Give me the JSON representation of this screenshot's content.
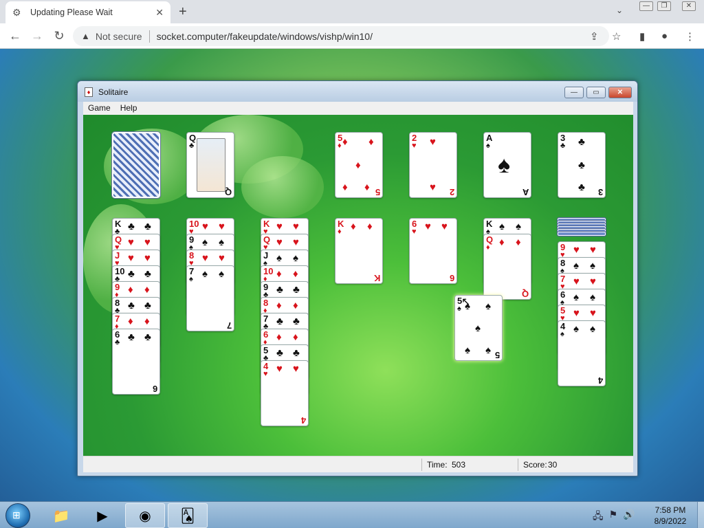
{
  "browser": {
    "tab_title": "Updating Please Wait",
    "tab_close": "✕",
    "new_tab": "+",
    "tab_search": "⌄",
    "minimize": "—",
    "restore": "❐",
    "close": "✕",
    "back": "←",
    "forward": "→",
    "reload": "↻",
    "security_label": "Not secure",
    "url": "socket.computer/fakeupdate/windows/vishp/win10/"
  },
  "window": {
    "title": "Solitaire",
    "menu": [
      "Game",
      "Help"
    ],
    "status": {
      "time_label": "Time:",
      "time_value": "503",
      "score_label": "Score:",
      "score_value": "30"
    }
  },
  "game": {
    "stock": {
      "face_down": true
    },
    "waste": {
      "rank": "Q",
      "suit": "♣"
    },
    "foundations": [
      {
        "rank": "5",
        "suit": "♦"
      },
      {
        "rank": "2",
        "suit": "♥"
      },
      {
        "rank": "A",
        "suit": "♠"
      },
      {
        "rank": "3",
        "suit": "♣"
      }
    ],
    "tableau": [
      {
        "cards": [
          "K♣",
          "Q♥",
          "J♥",
          "10♣",
          "9♦",
          "8♣",
          "7♦",
          "6♣"
        ]
      },
      {
        "cards": [
          "10♥",
          "9♠",
          "8♥",
          "7♠"
        ]
      },
      {
        "cards": [
          "K♥",
          "Q♥",
          "J♠",
          "10♦",
          "9♣",
          "8♦",
          "7♣",
          "6♦",
          "5♣",
          "4♥"
        ]
      },
      {
        "cards": [
          "K♦"
        ]
      },
      {
        "cards": [
          "6♥"
        ]
      },
      {
        "cards": [
          "K♠",
          "Q♦"
        ]
      },
      {
        "cards": [
          "9♥",
          "8♠",
          "7♥",
          "6♠",
          "5♥",
          "4♠"
        ],
        "face_down_count": 6
      }
    ],
    "dragging": {
      "rank": "5",
      "suit": "♠"
    }
  },
  "taskbar": {
    "clock_time": "7:58 PM",
    "clock_date": "8/9/2022"
  }
}
